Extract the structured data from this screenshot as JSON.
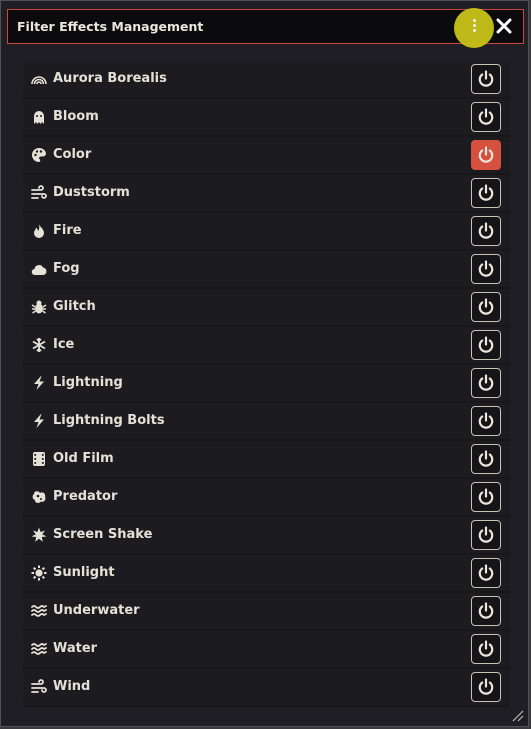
{
  "window": {
    "title": "Filter Effects Management",
    "menu_icon": "vertical-dots-icon",
    "close_icon": "close-icon"
  },
  "colors": {
    "accent_active": "#d6503f",
    "menu_highlight": "#c8c21a",
    "title_border": "#c8483a"
  },
  "filters": [
    {
      "label": "Aurora Borealis",
      "icon": "rainbow-icon",
      "active": false
    },
    {
      "label": "Bloom",
      "icon": "ghost-icon",
      "active": false
    },
    {
      "label": "Color",
      "icon": "palette-icon",
      "active": true
    },
    {
      "label": "Duststorm",
      "icon": "wind-icon",
      "active": false
    },
    {
      "label": "Fire",
      "icon": "fire-icon",
      "active": false
    },
    {
      "label": "Fog",
      "icon": "cloud-icon",
      "active": false
    },
    {
      "label": "Glitch",
      "icon": "bug-icon",
      "active": false
    },
    {
      "label": "Ice",
      "icon": "snowflake-icon",
      "active": false
    },
    {
      "label": "Lightning",
      "icon": "bolt-icon",
      "active": false
    },
    {
      "label": "Lightning Bolts",
      "icon": "bolt-icon",
      "active": false
    },
    {
      "label": "Old Film",
      "icon": "film-icon",
      "active": false
    },
    {
      "label": "Predator",
      "icon": "disease-icon",
      "active": false
    },
    {
      "label": "Screen Shake",
      "icon": "burst-icon",
      "active": false
    },
    {
      "label": "Sunlight",
      "icon": "sun-icon",
      "active": false
    },
    {
      "label": "Underwater",
      "icon": "water-icon",
      "active": false
    },
    {
      "label": "Water",
      "icon": "water-icon",
      "active": false
    },
    {
      "label": "Wind",
      "icon": "wind-icon",
      "active": false
    }
  ]
}
